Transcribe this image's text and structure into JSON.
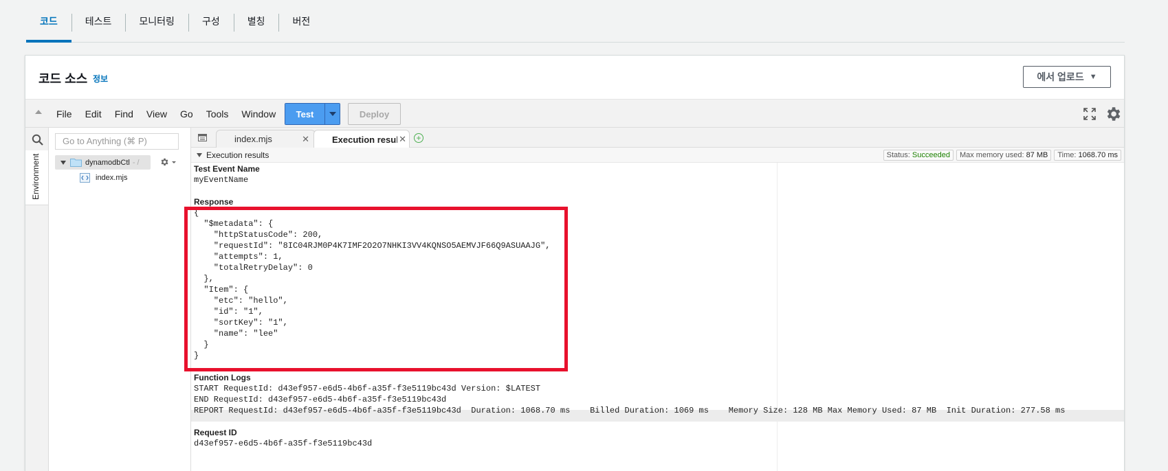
{
  "tabs": [
    {
      "label": "코드",
      "active": true
    },
    {
      "label": "테스트"
    },
    {
      "label": "모니터링"
    },
    {
      "label": "구성"
    },
    {
      "label": "별칭"
    },
    {
      "label": "버전"
    }
  ],
  "panel": {
    "title": "코드 소스",
    "info": "정보",
    "upload": "에서 업로드"
  },
  "menubar": {
    "items": [
      "File",
      "Edit",
      "Find",
      "View",
      "Go",
      "Tools",
      "Window"
    ],
    "test": "Test",
    "deploy": "Deploy"
  },
  "sidebar": {
    "env_label": "Environment",
    "search_placeholder": "Go to Anything (⌘ P)",
    "folder": "dynamodbCtl",
    "folder_suffix": "- /",
    "file": "index.mjs"
  },
  "editor": {
    "tab1": "index.mjs",
    "tab2": "Execution results",
    "results_title": "Execution results",
    "status_label": "Status:",
    "status_value": "Succeeded",
    "memory_label": "Max memory used:",
    "memory_value": "87 MB",
    "time_label": "Time:",
    "time_value": "1068.70 ms"
  },
  "output": {
    "test_event_heading": "Test Event Name",
    "test_event_value": "myEventName",
    "response_heading": "Response",
    "response_lines": [
      "{",
      "  \"$metadata\": {",
      "    \"httpStatusCode\": 200,",
      "    \"requestId\": \"8IC04RJM0P4K7IMF2O2O7NHKI3VV4KQNSO5AEMVJF66Q9ASUAAJG\",",
      "    \"attempts\": 1,",
      "    \"totalRetryDelay\": 0",
      "  },",
      "  \"Item\": {",
      "    \"etc\": \"hello\",",
      "    \"id\": \"1\",",
      "    \"sortKey\": \"1\",",
      "    \"name\": \"lee\"",
      "  }",
      "}"
    ],
    "logs_heading": "Function Logs",
    "log_lines": [
      "START RequestId: d43ef957-e6d5-4b6f-a35f-f3e5119bc43d Version: $LATEST",
      "END RequestId: d43ef957-e6d5-4b6f-a35f-f3e5119bc43d",
      "REPORT RequestId: d43ef957-e6d5-4b6f-a35f-f3e5119bc43d  Duration: 1068.70 ms    Billed Duration: 1069 ms    Memory Size: 128 MB Max Memory Used: 87 MB  Init Duration: 277.58 ms"
    ],
    "request_id_heading": "Request ID",
    "request_id_value": "d43ef957-e6d5-4b6f-a35f-f3e5119bc43d"
  },
  "colors": {
    "accent": "#0073bb",
    "test_button": "#4b9cf0",
    "success": "#1d8102",
    "highlight_box": "#e8112d"
  }
}
